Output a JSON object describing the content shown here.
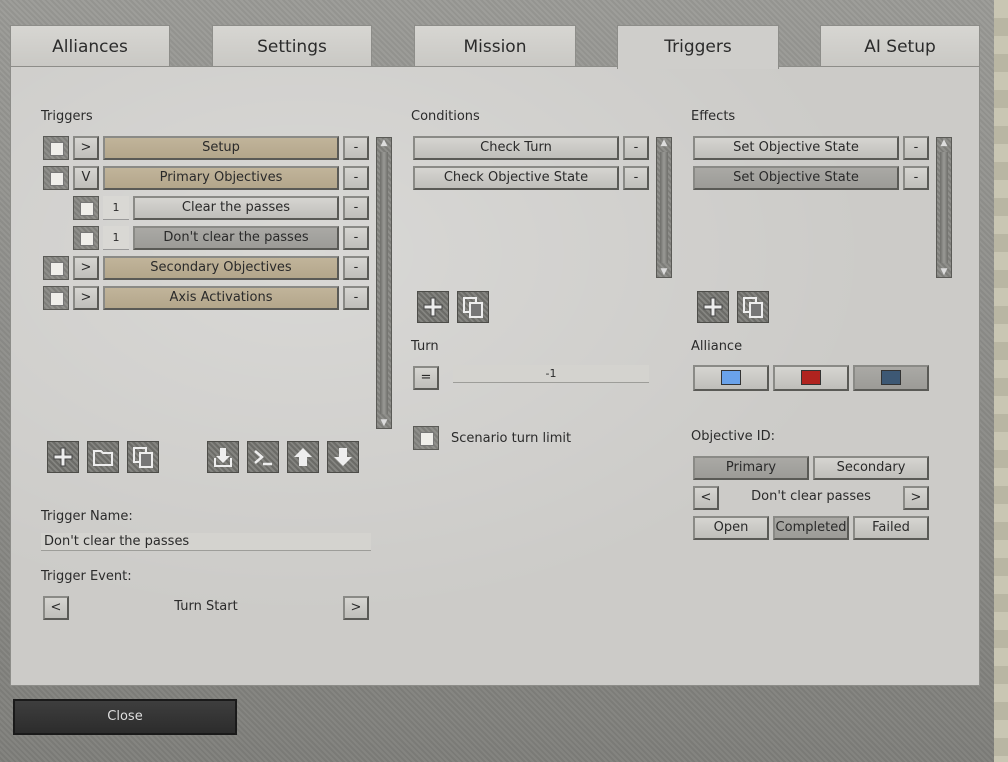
{
  "tabs": [
    {
      "label": "Alliances"
    },
    {
      "label": "Settings"
    },
    {
      "label": "Mission"
    },
    {
      "label": "Triggers"
    },
    {
      "label": "AI Setup"
    }
  ],
  "active_tab": "Triggers",
  "triggers": {
    "heading": "Triggers",
    "rows": [
      {
        "expand": ">",
        "label": "Setup",
        "remove": "-"
      },
      {
        "expand": "V",
        "label": "Primary Objectives",
        "remove": "-"
      },
      {
        "number": "1",
        "label": "Clear the passes",
        "remove": "-"
      },
      {
        "number": "1",
        "label": "Don't clear the passes",
        "remove": "-"
      },
      {
        "expand": ">",
        "label": "Secondary Objectives",
        "remove": "-"
      },
      {
        "expand": ">",
        "label": "Axis Activations",
        "remove": "-"
      }
    ],
    "toolbar_icons": [
      "add-icon",
      "folder-icon",
      "copy-icon",
      "import-icon",
      "console-icon",
      "move-up-icon",
      "move-down-icon"
    ],
    "name_label": "Trigger Name:",
    "name_value": "Don't clear the passes",
    "event_label": "Trigger Event:",
    "event_value": "Turn Start",
    "prev": "<",
    "next": ">"
  },
  "conditions": {
    "heading": "Conditions",
    "rows": [
      {
        "label": "Check Turn",
        "remove": "-"
      },
      {
        "label": "Check Objective State",
        "remove": "-"
      }
    ],
    "turn_label": "Turn",
    "turn_operator": "=",
    "turn_value": "-1",
    "scenario_limit_label": "Scenario turn limit"
  },
  "effects": {
    "heading": "Effects",
    "rows": [
      {
        "label": "Set Objective State",
        "remove": "-"
      },
      {
        "label": "Set Objective State",
        "remove": "-"
      }
    ],
    "alliance_label": "Alliance",
    "alliance_colors": [
      "#6aa2ea",
      "#b0231f",
      "#3d5874"
    ],
    "objective_id_label": "Objective ID:",
    "objective_types": [
      "Primary",
      "Secondary"
    ],
    "objective_prev": "<",
    "objective_next": ">",
    "objective_name": "Don't clear passes",
    "states": [
      "Open",
      "Completed",
      "Failed"
    ]
  },
  "footer": {
    "close_label": "Close"
  }
}
